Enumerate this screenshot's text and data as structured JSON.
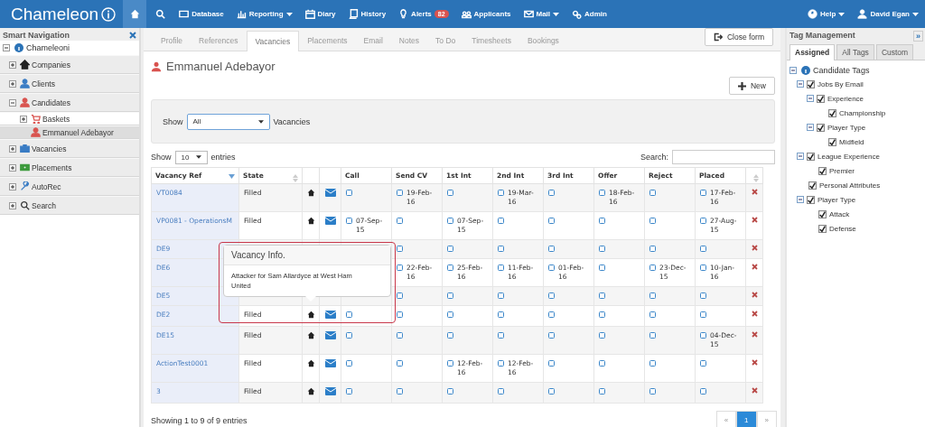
{
  "navbar": {
    "brand": "Chameleon",
    "items": [
      {
        "label": "Database",
        "caret": false
      },
      {
        "label": "Reporting",
        "caret": true
      },
      {
        "label": "Diary",
        "caret": false
      },
      {
        "label": "History",
        "caret": false
      },
      {
        "label": "Alerts",
        "caret": false,
        "badge": "82"
      },
      {
        "label": "Applicants",
        "caret": false
      },
      {
        "label": "Mail",
        "caret": true
      },
      {
        "label": "Admin",
        "caret": false
      }
    ],
    "right": [
      {
        "label": "Help"
      },
      {
        "label": "David Egan"
      }
    ]
  },
  "sidebar": {
    "title": "Smart Navigation",
    "root": "Chameleoni",
    "items": [
      {
        "label": "Companies",
        "expanded": false,
        "selected": false
      },
      {
        "label": "Clients",
        "expanded": false,
        "selected": false
      },
      {
        "label": "Candidates",
        "expanded": true,
        "selected": false,
        "children": [
          {
            "label": "Baskets",
            "expanded": false,
            "selected": false
          },
          {
            "label": "Emmanuel Adebayor",
            "selected": true
          }
        ]
      },
      {
        "label": "Vacancies",
        "expanded": false,
        "selected": false
      },
      {
        "label": "Placements",
        "expanded": false,
        "selected": false
      },
      {
        "label": "AutoRec",
        "expanded": false,
        "selected": false
      },
      {
        "label": "Search",
        "expanded": false,
        "selected": false
      }
    ]
  },
  "tabs": [
    {
      "label": "Profile",
      "selected": false
    },
    {
      "label": "References",
      "selected": false
    },
    {
      "label": "Vacancies",
      "selected": true
    },
    {
      "label": "Placements",
      "selected": false
    },
    {
      "label": "Email",
      "selected": false
    },
    {
      "label": "Notes",
      "selected": false
    },
    {
      "label": "To Do",
      "selected": false
    },
    {
      "label": "Timesheets",
      "selected": false
    },
    {
      "label": "Bookings",
      "selected": false
    }
  ],
  "close_button": "Close form",
  "candidate_name": "Emmanuel Adebayor",
  "new_button": "New",
  "filter": {
    "before": "Show",
    "value": "All",
    "after": "Vacancies"
  },
  "length": {
    "before": "Show",
    "value": "10",
    "after": "entries"
  },
  "search_label": "Search:",
  "table": {
    "columns": [
      "Vacancy Ref",
      "State",
      "Call",
      "Send CV",
      "1st Int",
      "2nd Int",
      "3rd Int",
      "Offer",
      "Reject",
      "Placed"
    ],
    "rows": [
      {
        "ref": "VT0084",
        "state": "Filled",
        "stages": [
          {
            "checked": false
          },
          {
            "checked": false,
            "date": "19-Feb-16"
          },
          {
            "checked": false
          },
          {
            "checked": false,
            "date": "19-Mar-16"
          },
          {
            "checked": false
          },
          {
            "checked": false,
            "date": "18-Feb-16"
          },
          {
            "checked": false
          },
          {
            "checked": false,
            "date": "17-Feb-16"
          }
        ]
      },
      {
        "ref": "VP0081 - OperationsM",
        "state": "Filled",
        "stages": [
          {
            "checked": false,
            "date": "07-Sep-15"
          },
          {
            "checked": false
          },
          {
            "checked": false,
            "date": "07-Sep-15"
          },
          {
            "checked": false
          },
          {
            "checked": false
          },
          {
            "checked": false
          },
          {
            "checked": false
          },
          {
            "checked": false,
            "date": "27-Aug-15"
          }
        ]
      },
      {
        "ref": "DE9",
        "stages": [
          {
            "checked": false
          },
          {
            "checked": false
          },
          {
            "checked": false
          },
          {
            "checked": false
          },
          {
            "checked": false
          },
          {
            "checked": false
          },
          {
            "checked": false
          }
        ]
      },
      {
        "ref": "DE6",
        "stages": [
          {
            "checked": false,
            "date": "22-Feb-16"
          },
          {
            "checked": false,
            "date": "25-Feb-16"
          },
          {
            "checked": false,
            "date": "11-Feb-16"
          },
          {
            "checked": false,
            "date": "01-Feb-16"
          },
          {
            "checked": false
          },
          {
            "checked": false,
            "date": "23-Dec-15"
          },
          {
            "checked": false,
            "date": "10-Jan-16"
          }
        ]
      },
      {
        "ref": "DE5",
        "stages": [
          {
            "checked": false
          },
          {
            "checked": false
          },
          {
            "checked": false
          },
          {
            "checked": false
          },
          {
            "checked": false
          },
          {
            "checked": false
          },
          {
            "checked": false
          }
        ]
      },
      {
        "ref": "DE2",
        "state": "Filled",
        "stages": [
          {
            "checked": false
          },
          {
            "checked": false
          },
          {
            "checked": false
          },
          {
            "checked": false
          },
          {
            "checked": false
          },
          {
            "checked": false
          },
          {
            "checked": false
          },
          {
            "checked": false
          }
        ]
      },
      {
        "ref": "DE15",
        "state": "Filled",
        "stages": [
          {
            "checked": false
          },
          {
            "checked": false
          },
          {
            "checked": false
          },
          {
            "checked": false
          },
          {
            "checked": false
          },
          {
            "checked": false
          },
          {
            "checked": false
          },
          {
            "checked": false,
            "date": "04-Dec-15"
          }
        ]
      },
      {
        "ref": "ActionTest0001",
        "state": "Filled",
        "stages": [
          {
            "checked": false
          },
          {
            "checked": false
          },
          {
            "checked": false,
            "date": "12-Feb-16"
          },
          {
            "checked": false,
            "date": "12-Feb-16"
          },
          {
            "checked": false
          },
          {
            "checked": false
          },
          {
            "checked": false
          },
          {
            "checked": false
          }
        ]
      },
      {
        "ref": "3",
        "state": "Filled",
        "stages": [
          {
            "checked": false
          },
          {
            "checked": false
          },
          {
            "checked": false
          },
          {
            "checked": false
          },
          {
            "checked": false
          },
          {
            "checked": false
          },
          {
            "checked": false
          },
          {
            "checked": false
          }
        ]
      }
    ]
  },
  "info": "Showing 1 to 9 of 9 entries",
  "pagination": [
    {
      "label": "«",
      "selected": false
    },
    {
      "label": "1",
      "selected": true
    },
    {
      "label": "»",
      "selected": false
    }
  ],
  "popover": {
    "title": "Vacancy Info.",
    "body": "Attacker for Sam Allardyce at West Ham United"
  },
  "tag_panel": {
    "title": "Tag Management",
    "collapse": "»",
    "tabs": [
      {
        "label": "Assigned",
        "selected": true
      },
      {
        "label": "All Tags",
        "selected": false
      },
      {
        "label": "Custom",
        "selected": false
      }
    ],
    "root": "Candidate Tags",
    "tree": [
      {
        "label": "Jobs By Email",
        "checked": true,
        "children": [
          {
            "label": "Experience",
            "checked": true,
            "children": [
              {
                "label": "Championship",
                "checked": true
              }
            ]
          },
          {
            "label": "Player Type",
            "checked": true,
            "children": [
              {
                "label": "Midfield",
                "checked": true
              }
            ]
          }
        ]
      },
      {
        "label": "League Experience",
        "checked": true,
        "children": [
          {
            "label": "Premier",
            "checked": true
          }
        ]
      },
      {
        "label": "Personal Attributes",
        "checked": true
      },
      {
        "label": "Player Type",
        "checked": true,
        "children": [
          {
            "label": "Attack",
            "checked": true
          },
          {
            "label": "Defense",
            "checked": true
          }
        ]
      }
    ]
  }
}
